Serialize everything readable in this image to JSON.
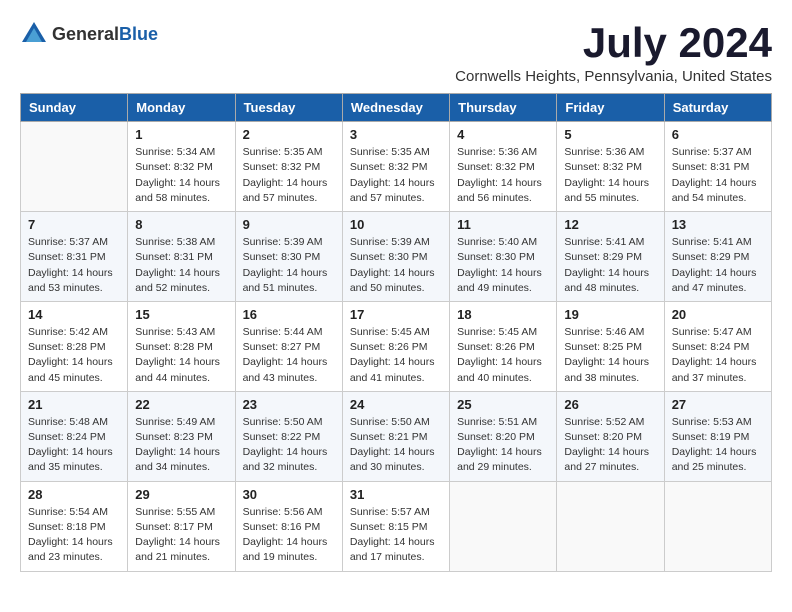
{
  "logo": {
    "text_general": "General",
    "text_blue": "Blue"
  },
  "title": "July 2024",
  "location": "Cornwells Heights, Pennsylvania, United States",
  "weekdays": [
    "Sunday",
    "Monday",
    "Tuesday",
    "Wednesday",
    "Thursday",
    "Friday",
    "Saturday"
  ],
  "weeks": [
    [
      {
        "day": "",
        "info": ""
      },
      {
        "day": "1",
        "info": "Sunrise: 5:34 AM\nSunset: 8:32 PM\nDaylight: 14 hours\nand 58 minutes."
      },
      {
        "day": "2",
        "info": "Sunrise: 5:35 AM\nSunset: 8:32 PM\nDaylight: 14 hours\nand 57 minutes."
      },
      {
        "day": "3",
        "info": "Sunrise: 5:35 AM\nSunset: 8:32 PM\nDaylight: 14 hours\nand 57 minutes."
      },
      {
        "day": "4",
        "info": "Sunrise: 5:36 AM\nSunset: 8:32 PM\nDaylight: 14 hours\nand 56 minutes."
      },
      {
        "day": "5",
        "info": "Sunrise: 5:36 AM\nSunset: 8:32 PM\nDaylight: 14 hours\nand 55 minutes."
      },
      {
        "day": "6",
        "info": "Sunrise: 5:37 AM\nSunset: 8:31 PM\nDaylight: 14 hours\nand 54 minutes."
      }
    ],
    [
      {
        "day": "7",
        "info": "Sunrise: 5:37 AM\nSunset: 8:31 PM\nDaylight: 14 hours\nand 53 minutes."
      },
      {
        "day": "8",
        "info": "Sunrise: 5:38 AM\nSunset: 8:31 PM\nDaylight: 14 hours\nand 52 minutes."
      },
      {
        "day": "9",
        "info": "Sunrise: 5:39 AM\nSunset: 8:30 PM\nDaylight: 14 hours\nand 51 minutes."
      },
      {
        "day": "10",
        "info": "Sunrise: 5:39 AM\nSunset: 8:30 PM\nDaylight: 14 hours\nand 50 minutes."
      },
      {
        "day": "11",
        "info": "Sunrise: 5:40 AM\nSunset: 8:30 PM\nDaylight: 14 hours\nand 49 minutes."
      },
      {
        "day": "12",
        "info": "Sunrise: 5:41 AM\nSunset: 8:29 PM\nDaylight: 14 hours\nand 48 minutes."
      },
      {
        "day": "13",
        "info": "Sunrise: 5:41 AM\nSunset: 8:29 PM\nDaylight: 14 hours\nand 47 minutes."
      }
    ],
    [
      {
        "day": "14",
        "info": "Sunrise: 5:42 AM\nSunset: 8:28 PM\nDaylight: 14 hours\nand 45 minutes."
      },
      {
        "day": "15",
        "info": "Sunrise: 5:43 AM\nSunset: 8:28 PM\nDaylight: 14 hours\nand 44 minutes."
      },
      {
        "day": "16",
        "info": "Sunrise: 5:44 AM\nSunset: 8:27 PM\nDaylight: 14 hours\nand 43 minutes."
      },
      {
        "day": "17",
        "info": "Sunrise: 5:45 AM\nSunset: 8:26 PM\nDaylight: 14 hours\nand 41 minutes."
      },
      {
        "day": "18",
        "info": "Sunrise: 5:45 AM\nSunset: 8:26 PM\nDaylight: 14 hours\nand 40 minutes."
      },
      {
        "day": "19",
        "info": "Sunrise: 5:46 AM\nSunset: 8:25 PM\nDaylight: 14 hours\nand 38 minutes."
      },
      {
        "day": "20",
        "info": "Sunrise: 5:47 AM\nSunset: 8:24 PM\nDaylight: 14 hours\nand 37 minutes."
      }
    ],
    [
      {
        "day": "21",
        "info": "Sunrise: 5:48 AM\nSunset: 8:24 PM\nDaylight: 14 hours\nand 35 minutes."
      },
      {
        "day": "22",
        "info": "Sunrise: 5:49 AM\nSunset: 8:23 PM\nDaylight: 14 hours\nand 34 minutes."
      },
      {
        "day": "23",
        "info": "Sunrise: 5:50 AM\nSunset: 8:22 PM\nDaylight: 14 hours\nand 32 minutes."
      },
      {
        "day": "24",
        "info": "Sunrise: 5:50 AM\nSunset: 8:21 PM\nDaylight: 14 hours\nand 30 minutes."
      },
      {
        "day": "25",
        "info": "Sunrise: 5:51 AM\nSunset: 8:20 PM\nDaylight: 14 hours\nand 29 minutes."
      },
      {
        "day": "26",
        "info": "Sunrise: 5:52 AM\nSunset: 8:20 PM\nDaylight: 14 hours\nand 27 minutes."
      },
      {
        "day": "27",
        "info": "Sunrise: 5:53 AM\nSunset: 8:19 PM\nDaylight: 14 hours\nand 25 minutes."
      }
    ],
    [
      {
        "day": "28",
        "info": "Sunrise: 5:54 AM\nSunset: 8:18 PM\nDaylight: 14 hours\nand 23 minutes."
      },
      {
        "day": "29",
        "info": "Sunrise: 5:55 AM\nSunset: 8:17 PM\nDaylight: 14 hours\nand 21 minutes."
      },
      {
        "day": "30",
        "info": "Sunrise: 5:56 AM\nSunset: 8:16 PM\nDaylight: 14 hours\nand 19 minutes."
      },
      {
        "day": "31",
        "info": "Sunrise: 5:57 AM\nSunset: 8:15 PM\nDaylight: 14 hours\nand 17 minutes."
      },
      {
        "day": "",
        "info": ""
      },
      {
        "day": "",
        "info": ""
      },
      {
        "day": "",
        "info": ""
      }
    ]
  ]
}
